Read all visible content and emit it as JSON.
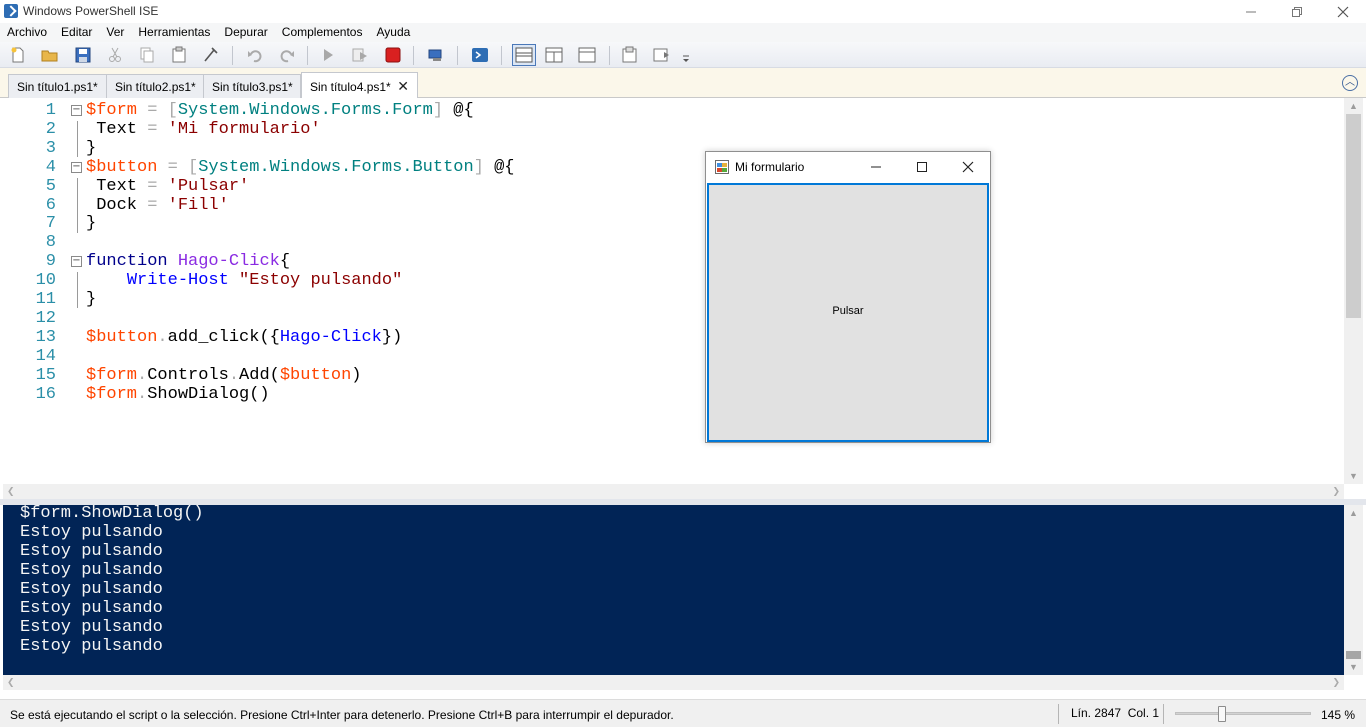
{
  "window": {
    "title": "Windows PowerShell ISE"
  },
  "menu": [
    "Archivo",
    "Editar",
    "Ver",
    "Herramientas",
    "Depurar",
    "Complementos",
    "Ayuda"
  ],
  "tabs": [
    {
      "label": "Sin título1.ps1*",
      "active": false
    },
    {
      "label": "Sin título2.ps1*",
      "active": false
    },
    {
      "label": "Sin título3.ps1*",
      "active": false
    },
    {
      "label": "Sin título4.ps1*",
      "active": true
    }
  ],
  "editor": {
    "lines": [
      {
        "n": "1",
        "tokens": [
          [
            "v",
            "$form"
          ],
          [
            "o",
            " = "
          ],
          [
            "o",
            "["
          ],
          [
            "t",
            "System.Windows.Forms.Form"
          ],
          [
            "o",
            "]"
          ],
          [
            "p",
            " @{"
          ]
        ]
      },
      {
        "n": "2",
        "tokens": [
          [
            "p",
            " Text "
          ],
          [
            "o",
            "="
          ],
          [
            "p",
            " "
          ],
          [
            "s",
            "'Mi formulario'"
          ]
        ]
      },
      {
        "n": "3",
        "tokens": [
          [
            "p",
            "}"
          ]
        ]
      },
      {
        "n": "4",
        "tokens": [
          [
            "v",
            "$button"
          ],
          [
            "o",
            " = "
          ],
          [
            "o",
            "["
          ],
          [
            "t",
            "System.Windows.Forms.Button"
          ],
          [
            "o",
            "]"
          ],
          [
            "p",
            " @{"
          ]
        ]
      },
      {
        "n": "5",
        "tokens": [
          [
            "p",
            " Text "
          ],
          [
            "o",
            "="
          ],
          [
            "p",
            " "
          ],
          [
            "s",
            "'Pulsar'"
          ]
        ]
      },
      {
        "n": "6",
        "tokens": [
          [
            "p",
            " Dock "
          ],
          [
            "o",
            "="
          ],
          [
            "p",
            " "
          ],
          [
            "s",
            "'Fill'"
          ]
        ]
      },
      {
        "n": "7",
        "tokens": [
          [
            "p",
            "}"
          ]
        ]
      },
      {
        "n": "8",
        "tokens": []
      },
      {
        "n": "9",
        "tokens": [
          [
            "k",
            "function"
          ],
          [
            "p",
            " "
          ],
          [
            "fn",
            "Hago-Click"
          ],
          [
            "p",
            "{"
          ]
        ]
      },
      {
        "n": "10",
        "tokens": [
          [
            "p",
            "    "
          ],
          [
            "c",
            "Write-Host"
          ],
          [
            "p",
            " "
          ],
          [
            "s",
            "\"Estoy pulsando\""
          ]
        ]
      },
      {
        "n": "11",
        "tokens": [
          [
            "p",
            "}"
          ]
        ]
      },
      {
        "n": "12",
        "tokens": []
      },
      {
        "n": "13",
        "tokens": [
          [
            "v",
            "$button"
          ],
          [
            "o",
            "."
          ],
          [
            "p",
            "add_click({"
          ],
          [
            "c",
            "Hago-Click"
          ],
          [
            "p",
            "})"
          ]
        ]
      },
      {
        "n": "14",
        "tokens": []
      },
      {
        "n": "15",
        "tokens": [
          [
            "v",
            "$form"
          ],
          [
            "o",
            "."
          ],
          [
            "p",
            "Controls"
          ],
          [
            "o",
            "."
          ],
          [
            "p",
            "Add("
          ],
          [
            "v",
            "$button"
          ],
          [
            "p",
            ")"
          ]
        ]
      },
      {
        "n": "16",
        "tokens": [
          [
            "v",
            "$form"
          ],
          [
            "o",
            "."
          ],
          [
            "p",
            "ShowDialog()"
          ]
        ]
      }
    ]
  },
  "console": {
    "lines": [
      "$form.ShowDialog()",
      "Estoy pulsando",
      "Estoy pulsando",
      "Estoy pulsando",
      "Estoy pulsando",
      "Estoy pulsando",
      "Estoy pulsando",
      "Estoy pulsando"
    ]
  },
  "status": {
    "message": "Se está ejecutando el script o la selección. Presione Ctrl+Inter para detenerlo. Presione Ctrl+B para interrumpir el depurador.",
    "position": "Lín. 2847  Col. 1",
    "zoom": "145 %",
    "zoom_fraction": 0.33
  },
  "form": {
    "title": "Mi formulario",
    "button": "Pulsar"
  },
  "colors": {
    "console_bg": "#012456",
    "variable": "#ff4500",
    "type": "#008080",
    "string": "#8b0000",
    "keyword": "#00008b",
    "command": "#0000ff",
    "function_name": "#8a2be2"
  }
}
